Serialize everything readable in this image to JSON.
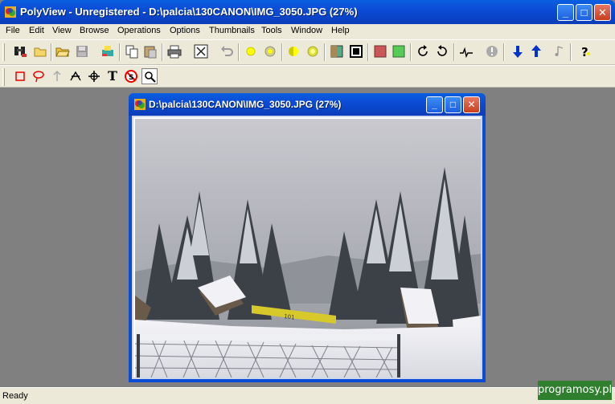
{
  "window": {
    "title": "PolyView - Unregistered - D:\\palcia\\130CANON\\IMG_3050.JPG (27%)",
    "min_label": "_",
    "max_label": "□",
    "close_label": "✕"
  },
  "menu": {
    "items": [
      "File",
      "Edit",
      "View",
      "Browse",
      "Operations",
      "Options",
      "Thumbnails",
      "Tools",
      "Window",
      "Help"
    ]
  },
  "toolbar1": {
    "icons": [
      "binoculars-icon",
      "new-folder-icon",
      "open-folder-icon",
      "save-icon",
      "scan-icon",
      "copy-icon",
      "paste-icon",
      "print-icon",
      "fit-window-icon",
      "undo-icon",
      "brightness-up-icon",
      "brightness-down-icon",
      "contrast-up-icon",
      "contrast-down-icon",
      "color-balance-icon",
      "frame-icon",
      "red-color-icon",
      "green-color-icon",
      "rotate-right-icon",
      "rotate-left-icon",
      "histogram-icon",
      "alert-icon",
      "move-down-icon",
      "move-up-icon",
      "music-icon",
      "help-icon"
    ]
  },
  "toolbar2": {
    "icons": [
      "rectangle-select-icon",
      "lasso-select-icon",
      "arrow-icon",
      "crop-icon",
      "move-icon",
      "text-icon",
      "no-entry-icon",
      "zoom-icon"
    ],
    "text_tool_label": "T"
  },
  "child_window": {
    "title": "D:\\palcia\\130CANON\\IMG_3050.JPG (27%)",
    "min_label": "_",
    "max_label": "□",
    "close_label": "✕",
    "zoom_percent": 27,
    "sign_text": "101"
  },
  "status": {
    "text": "Ready"
  },
  "watermark": {
    "text": "programosy.pl"
  },
  "colors": {
    "title_blue": "#0b4cd6",
    "close_red": "#c8401f",
    "chrome": "#ece9d8",
    "mdi_bg": "#808080"
  }
}
